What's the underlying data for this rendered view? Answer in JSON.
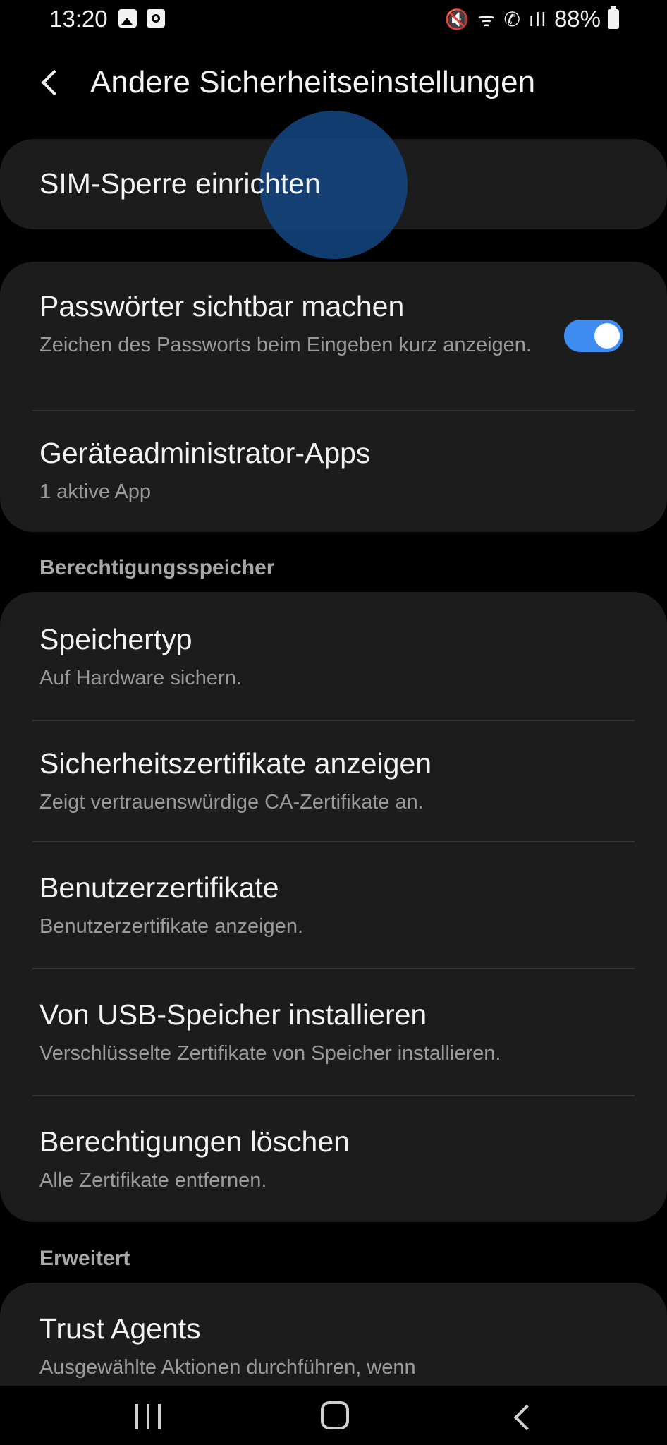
{
  "status_bar": {
    "time": "13:20",
    "left_icons": [
      "gallery-icon",
      "screen-record-icon"
    ],
    "right_icons": [
      "mute-icon",
      "wifi-icon",
      "wifi-call-icon",
      "signal-icon"
    ],
    "right_glyphs": "🔇 ᯤ ✆ ıll",
    "battery": "88%"
  },
  "header": {
    "title": "Andere Sicherheitseinstellungen"
  },
  "sim_card": {
    "title": "SIM-Sperre einrichten"
  },
  "security_card": {
    "passwords": {
      "title": "Passwörter sichtbar machen",
      "subtitle": "Zeichen des Passworts beim Eingeben kurz anzeigen.",
      "toggle_on": true
    },
    "device_admin": {
      "title": "Geräteadministrator-Apps",
      "subtitle": "1 aktive App"
    }
  },
  "credential_storage": {
    "section_title": "Berechtigungsspeicher",
    "items": [
      {
        "title": "Speichertyp",
        "subtitle": "Auf Hardware sichern."
      },
      {
        "title": "Sicherheitszertifikate anzeigen",
        "subtitle": "Zeigt vertrauenswürdige CA-Zertifikate an."
      },
      {
        "title": "Benutzerzertifikate",
        "subtitle": "Benutzerzertifikate anzeigen."
      },
      {
        "title": "Von USB-Speicher installieren",
        "subtitle": "Verschlüsselte Zertifikate von Speicher installieren."
      },
      {
        "title": "Berechtigungen löschen",
        "subtitle": "Alle Zertifikate entfernen."
      }
    ]
  },
  "advanced": {
    "section_title": "Erweitert",
    "trust_agents": {
      "title": "Trust Agents",
      "subtitle": "Ausgewählte Aktionen durchführen, wenn"
    }
  },
  "colors": {
    "background": "#000000",
    "card": "#1c1c1c",
    "accent": "#3e8cf1",
    "subtitle": "#9a9a9a"
  }
}
